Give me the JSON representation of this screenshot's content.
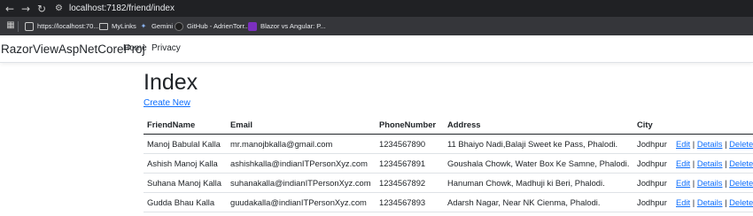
{
  "browser": {
    "url": "localhost:7182/friend/index",
    "bookmarks": [
      {
        "label": "https://localhost:70...",
        "icon": "page-icon"
      },
      {
        "label": "MyLinks",
        "icon": "folder-icon"
      },
      {
        "label": "Gemini",
        "icon": "gemini-icon"
      },
      {
        "label": "GitHub - AdrienTorr...",
        "icon": "github-icon"
      },
      {
        "label": "Blazor vs Angular: P...",
        "icon": "site-icon"
      }
    ]
  },
  "navbar": {
    "brand": "RazorViewAspNetCoreProj",
    "links": [
      "Home",
      "Privacy"
    ]
  },
  "page": {
    "title": "Index",
    "create_link": "Create New"
  },
  "table": {
    "headers": [
      "FriendName",
      "Email",
      "PhoneNumber",
      "Address",
      "City"
    ],
    "rows": [
      {
        "name": "Manoj Babulal Kalla",
        "email": "mr.manojbkalla@gmail.com",
        "phone": "1234567890",
        "address": "11 Bhaiyo Nadi,Balaji Sweet ke Pass, Phalodi.",
        "city": "Jodhpur"
      },
      {
        "name": "Ashish Manoj Kalla",
        "email": "ashishkalla@indianITPersonXyz.com",
        "phone": "1234567891",
        "address": "Goushala Chowk, Water Box Ke Samne, Phalodi.",
        "city": "Jodhpur"
      },
      {
        "name": "Suhana Manoj Kalla",
        "email": "suhanakalla@indianITPersonXyz.com",
        "phone": "1234567892",
        "address": "Hanuman Chowk, Madhuji ki Beri, Phalodi.",
        "city": "Jodhpur"
      },
      {
        "name": "Gudda Bhau Kalla",
        "email": "guudakalla@indianITPersonXyz.com",
        "phone": "1234567893",
        "address": "Adarsh Nagar, Near NK Cienma, Phalodi.",
        "city": "Jodhpur"
      }
    ],
    "actions": {
      "edit": "Edit",
      "details": "Details",
      "delete": "Delete",
      "separator": "|"
    }
  }
}
